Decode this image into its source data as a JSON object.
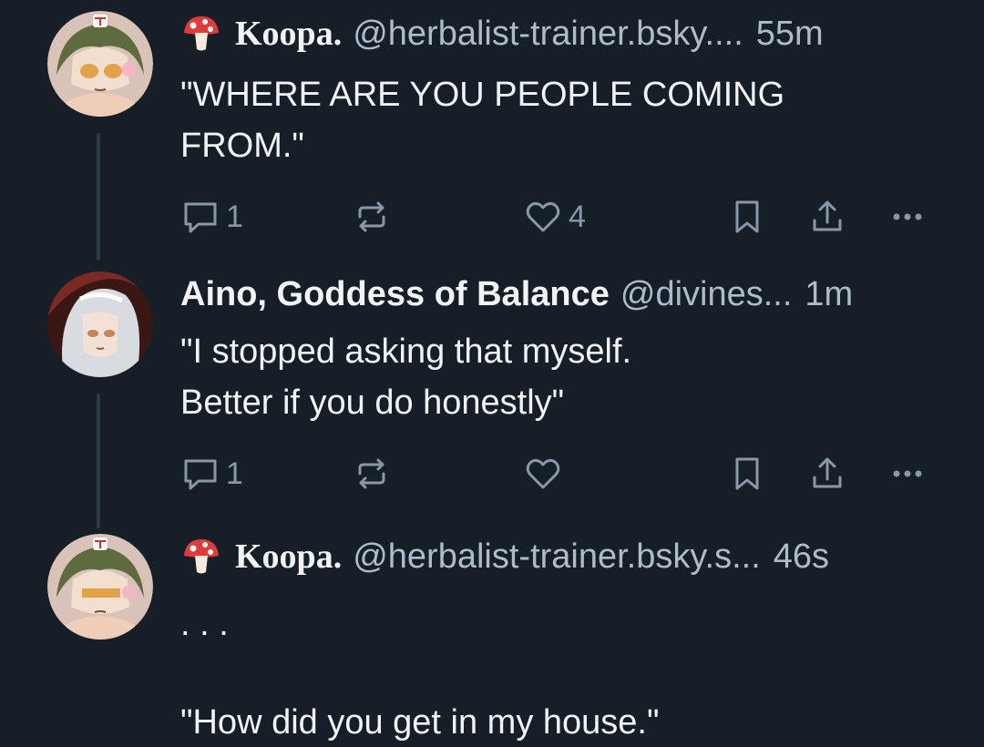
{
  "posts": [
    {
      "name": "Koopa.",
      "handle": "@herbalist-trainer.bsky....",
      "time": "55m",
      "text": "\"WHERE ARE YOU PEOPLE COMING\nFROM.\"",
      "reply_count": "1",
      "like_count": "4",
      "avatar": "koopa-avatar"
    },
    {
      "name": "Aino, Goddess of Balance",
      "handle": "@divines...",
      "time": "1m",
      "text": "\"I stopped asking that myself.\nBetter if you do honestly\"",
      "reply_count": "1",
      "like_count": "",
      "avatar": "aino-avatar"
    },
    {
      "name": "Koopa.",
      "handle": "@herbalist-trainer.bsky.s...",
      "time": "46s",
      "text": ". . .\n\n\"How did you get in my house.\"",
      "avatar": "koopa-avatar"
    }
  ],
  "icons": {
    "reply": "reply-icon",
    "repost": "repost-icon",
    "like": "heart-icon",
    "bookmark": "bookmark-icon",
    "share": "share-icon",
    "more": "more-icon",
    "mushroom": "mushroom-icon"
  },
  "colors": {
    "background": "#161e27",
    "text": "#f1f3f5",
    "muted": "#aebbc9",
    "icon": "#8898a8",
    "thread_line": "#2e3945"
  }
}
